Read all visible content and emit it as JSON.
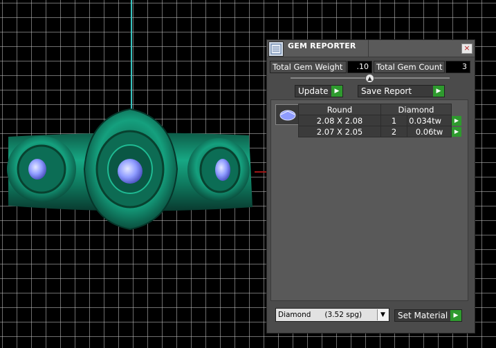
{
  "panel": {
    "title": "GEM REPORTER",
    "close": "×",
    "total_gem_weight_label": "Total Gem Weight",
    "total_gem_weight_value": ".10",
    "total_gem_count_label": "Total Gem Count",
    "total_gem_count_value": "3",
    "update_label": "Update",
    "save_report_label": "Save Report",
    "table": {
      "headers": [
        "Round",
        "Diamond"
      ],
      "rows": [
        {
          "size": "2.08 X 2.08",
          "count": "1",
          "weight": "0.034tw"
        },
        {
          "size": "2.07 X 2.05",
          "count": "2",
          "weight": "0.06tw"
        }
      ]
    },
    "material_select": "Diamond      (3.52 spg)",
    "set_material_label": "Set Material"
  },
  "icons": {
    "arrow": "▶",
    "caret": "▼",
    "slider": "▲"
  },
  "colors": {
    "ring": "#139a77",
    "gem": "#8f9cff",
    "accent_button": "#2e9a2e",
    "axis": "#39c4c0"
  }
}
